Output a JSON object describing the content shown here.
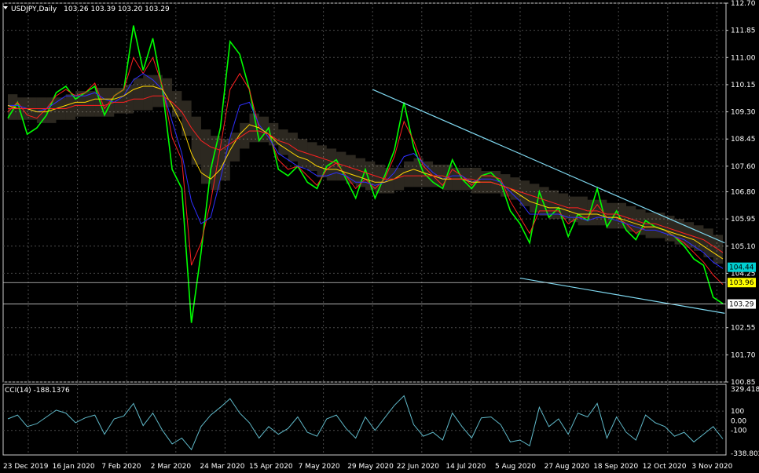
{
  "header": {
    "symbol": "USDJPY,Daily",
    "ohlc": "103.26 103.39 103.20 103.29"
  },
  "indicator": {
    "label": "CCI(14) -188.1376"
  },
  "colors": {
    "background": "#000000",
    "grid": "#4a4a4a",
    "candles": "#00ff00",
    "close_line": "#7cfc00",
    "tenkan": "#ff2020",
    "kijun": "#2f2fff",
    "span_a": "#ffd700",
    "cloud": "#f5deb3",
    "trendline": "#7fd8f0",
    "cci": "#5fb8c8",
    "tag_cyan": "#00ced1",
    "tag_yellow": "#ffff00"
  },
  "chart_data": [
    {
      "type": "line",
      "title": "USDJPY,Daily",
      "ylim": [
        100.85,
        112.7
      ],
      "y_ticks": [
        "112.70",
        "111.85",
        "111.00",
        "110.15",
        "109.30",
        "108.45",
        "107.60",
        "106.80",
        "105.95",
        "105.10",
        "104.25",
        "102.55",
        "101.70",
        "100.85"
      ],
      "x_ticks": [
        "23 Dec 2019",
        "16 Jan 2020",
        "7 Feb 2020",
        "2 Mar 2020",
        "24 Mar 2020",
        "15 Apr 2020",
        "7 May 2020",
        "29 May 2020",
        "22 Jun 2020",
        "14 Jul 2020",
        "5 Aug 2020",
        "27 Aug 2020",
        "18 Sep 2020",
        "12 Oct 2020",
        "3 Nov 2020"
      ],
      "price_tags": [
        {
          "label": "104.44",
          "value": 104.44,
          "color": "cyan"
        },
        {
          "label": "103.96",
          "value": 103.96,
          "color": "yellow"
        },
        {
          "label": "103.29",
          "value": 103.29,
          "color": "white"
        }
      ],
      "series": [
        {
          "values": [
            109.1,
            109.6,
            108.6,
            108.8,
            109.2,
            109.9,
            110.1,
            109.7,
            109.9,
            110.1,
            109.2,
            109.8,
            110.0,
            112.0,
            110.6,
            111.6,
            110.0,
            107.5,
            106.9,
            102.7,
            104.9,
            107.5,
            108.8,
            111.5,
            111.1,
            110.0,
            108.4,
            108.8,
            107.5,
            107.3,
            107.6,
            107.1,
            106.9,
            107.6,
            107.8,
            107.2,
            106.6,
            107.5,
            106.6,
            107.3,
            108.1,
            109.6,
            108.2,
            107.4,
            107.1,
            106.9,
            107.8,
            107.2,
            106.9,
            107.3,
            107.4,
            107.1,
            106.2,
            105.8,
            105.2,
            106.8,
            106.0,
            106.3,
            105.4,
            106.1,
            105.9,
            106.9,
            105.7,
            106.2,
            105.6,
            105.3,
            105.9,
            105.7,
            105.6,
            105.4,
            105.1,
            104.7,
            104.5,
            103.5,
            103.3
          ]
        },
        {
          "values": [
            109.3,
            109.6,
            109.2,
            109.1,
            109.4,
            109.8,
            110.0,
            109.8,
            109.9,
            110.2,
            109.4,
            109.8,
            110.0,
            111.0,
            110.5,
            111.0,
            110.1,
            108.5,
            107.8,
            104.5,
            105.2,
            106.5,
            108.2,
            110.0,
            110.5,
            110.0,
            108.8,
            108.6,
            107.8,
            107.5,
            107.6,
            107.3,
            107.0,
            107.5,
            107.7,
            107.3,
            106.9,
            107.2,
            106.9,
            107.2,
            107.9,
            109.0,
            108.4,
            107.6,
            107.3,
            107.0,
            107.5,
            107.3,
            107.0,
            107.3,
            107.3,
            107.2,
            106.5,
            106.0,
            105.5,
            106.2,
            106.2,
            106.2,
            105.8,
            106.0,
            106.0,
            106.4,
            106.0,
            106.0,
            105.8,
            105.5,
            105.7,
            105.7,
            105.6,
            105.4,
            105.2,
            104.9,
            104.6,
            104.2,
            103.9
          ]
        },
        {
          "values": [
            109.5,
            109.5,
            109.4,
            109.3,
            109.4,
            109.6,
            109.8,
            109.8,
            109.8,
            109.9,
            109.7,
            109.6,
            109.8,
            110.3,
            110.5,
            110.3,
            110.0,
            109.0,
            108.0,
            106.5,
            105.8,
            106.0,
            107.2,
            108.5,
            109.5,
            109.6,
            108.9,
            108.5,
            108.0,
            107.8,
            107.6,
            107.5,
            107.3,
            107.3,
            107.4,
            107.3,
            107.1,
            107.1,
            107.0,
            107.1,
            107.4,
            107.9,
            108.0,
            107.7,
            107.4,
            107.2,
            107.3,
            107.3,
            107.1,
            107.2,
            107.2,
            107.1,
            106.8,
            106.5,
            106.1,
            106.1,
            106.1,
            106.1,
            106.0,
            106.0,
            105.9,
            106.0,
            106.0,
            105.9,
            105.8,
            105.7,
            105.6,
            105.6,
            105.5,
            105.4,
            105.3,
            105.1,
            104.9,
            104.6,
            104.4
          ]
        },
        {
          "values": [
            109.5,
            109.4,
            109.4,
            109.3,
            109.3,
            109.4,
            109.5,
            109.6,
            109.6,
            109.7,
            109.7,
            109.7,
            109.8,
            110.0,
            110.1,
            110.1,
            110.0,
            109.5,
            108.9,
            108.0,
            107.4,
            107.2,
            107.5,
            108.1,
            108.6,
            108.9,
            108.8,
            108.6,
            108.3,
            108.1,
            107.9,
            107.8,
            107.6,
            107.5,
            107.5,
            107.4,
            107.3,
            107.2,
            107.1,
            107.1,
            107.2,
            107.4,
            107.5,
            107.4,
            107.3,
            107.2,
            107.2,
            107.2,
            107.1,
            107.1,
            107.1,
            107.0,
            106.9,
            106.7,
            106.5,
            106.4,
            106.3,
            106.3,
            106.2,
            106.1,
            106.1,
            106.1,
            106.0,
            106.0,
            105.9,
            105.8,
            105.7,
            105.7,
            105.6,
            105.5,
            105.4,
            105.3,
            105.1,
            104.9,
            104.7
          ]
        },
        {
          "values": [
            109.4,
            109.4,
            109.4,
            109.4,
            109.4,
            109.4,
            109.4,
            109.5,
            109.5,
            109.5,
            109.5,
            109.6,
            109.6,
            109.7,
            109.7,
            109.8,
            109.8,
            109.6,
            109.3,
            108.8,
            108.4,
            108.2,
            108.1,
            108.3,
            108.5,
            108.7,
            108.7,
            108.6,
            108.4,
            108.3,
            108.1,
            108.0,
            107.9,
            107.8,
            107.7,
            107.6,
            107.5,
            107.4,
            107.3,
            107.2,
            107.2,
            107.3,
            107.3,
            107.3,
            107.3,
            107.3,
            107.2,
            107.2,
            107.2,
            107.1,
            107.1,
            107.0,
            106.9,
            106.8,
            106.7,
            106.6,
            106.5,
            106.4,
            106.3,
            106.3,
            106.2,
            106.2,
            106.1,
            106.1,
            106.0,
            105.9,
            105.8,
            105.8,
            105.7,
            105.6,
            105.5,
            105.4,
            105.3,
            105.1,
            104.9
          ]
        }
      ],
      "trendlines": [
        {
          "x0": "29 May 2020",
          "y0": 110.0,
          "x1": "3 Nov 2020",
          "y1": 105.2
        },
        {
          "x0": "5 Aug 2020",
          "y0": 104.1,
          "x1": "3 Nov 2020",
          "y1": 103.0
        }
      ]
    },
    {
      "type": "line",
      "title": "CCI(14) -188.1376",
      "ylim": [
        -338.802,
        329.4185
      ],
      "y_ticks": [
        "329.4185",
        "100",
        "0.00",
        "-100",
        "-338.802"
      ],
      "series": [
        {
          "values": [
            20,
            60,
            -60,
            -30,
            40,
            110,
            80,
            -20,
            30,
            60,
            -140,
            20,
            50,
            180,
            -50,
            80,
            -100,
            -240,
            -180,
            -300,
            -60,
            60,
            140,
            230,
            80,
            -20,
            -180,
            -60,
            -140,
            -80,
            40,
            -120,
            -160,
            20,
            60,
            -80,
            -180,
            40,
            -100,
            30,
            160,
            260,
            -40,
            -160,
            -120,
            -200,
            80,
            -60,
            -180,
            30,
            40,
            -40,
            -220,
            -200,
            -260,
            140,
            -60,
            20,
            -140,
            80,
            40,
            180,
            -180,
            40,
            -120,
            -200,
            60,
            -20,
            -60,
            -160,
            -120,
            -220,
            -140,
            -60,
            -188
          ]
        }
      ]
    }
  ]
}
